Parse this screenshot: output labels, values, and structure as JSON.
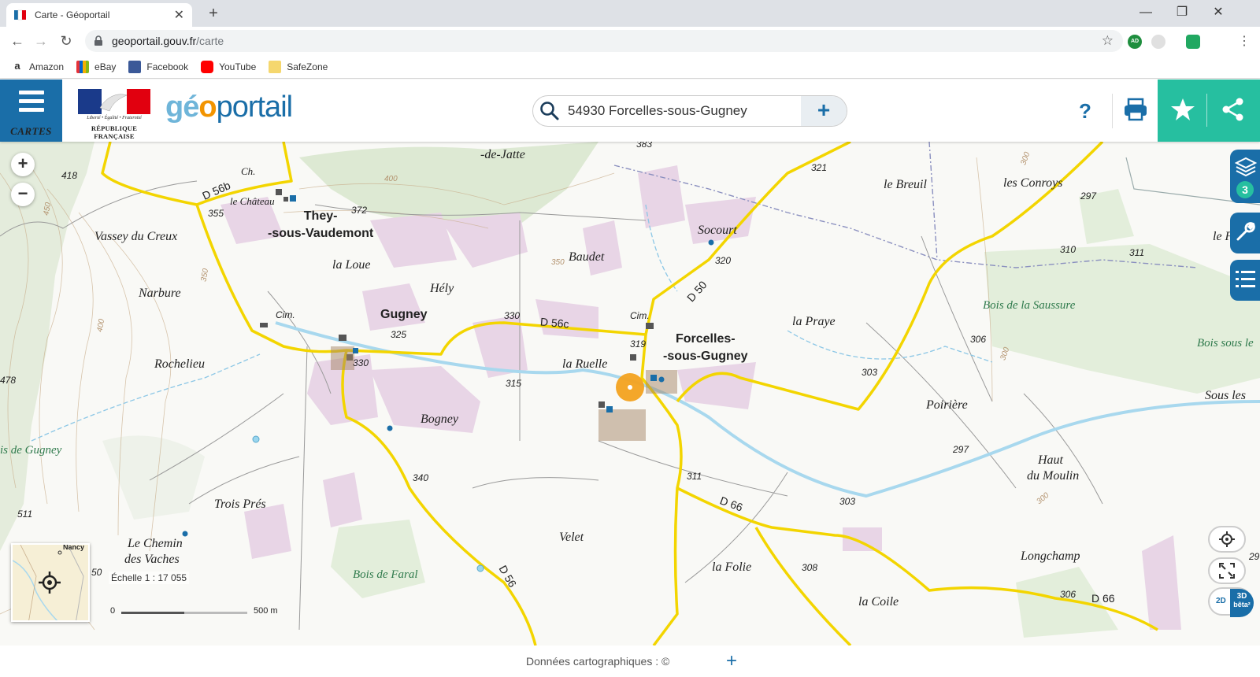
{
  "browser": {
    "tab_title": "Carte - Géoportail",
    "url_host": "geoportail.gouv.fr",
    "url_path": "/carte",
    "bookmarks": [
      "Amazon",
      "eBay",
      "Facebook",
      "YouTube",
      "SafeZone"
    ],
    "ext_ad_label": "AD"
  },
  "header": {
    "cartes_label": "CARTES",
    "rf_devise": "Liberté • Égalité • Fraternité",
    "rf_rep": "RÉPUBLIQUE FRANÇAISE",
    "logo_a": "gé",
    "logo_b": "o",
    "logo_c": "portail",
    "search_value": "54930 Forcelles-sous-Gugney",
    "help_label": "?"
  },
  "map": {
    "places": [
      "They-",
      "-sous-Vaudemont",
      "Gugney",
      "Forcelles-",
      "-sous-Gugney"
    ],
    "localities": [
      "-de-Jatte",
      "le Château",
      "Vassey du Creux",
      "la Loue",
      "Hély",
      "Baudet",
      "Socourt",
      "le Breuil",
      "les Conroys",
      "Narbure",
      "Rochelieu",
      "la Ruelle",
      "la Praye",
      "Bogney",
      "Poirière",
      "Haut",
      "du Moulin",
      "Trois Prés",
      "Velet",
      "Le Chemin",
      "des Vaches",
      "la Folie",
      "la Coile",
      "Longchamp",
      "Sous les",
      "le F",
      "Ch."
    ],
    "woods": [
      "Bois de la Saussure",
      "Bois de Faral",
      "Bois sous le",
      "is de Gugney"
    ],
    "roads": [
      "D 56b",
      "D 56c",
      "D 50",
      "D 66",
      "D 56",
      "D 66",
      "Cim.",
      "Cim."
    ],
    "altitudes": [
      "383",
      "418",
      "355",
      "372",
      "330",
      "325",
      "330",
      "319",
      "321",
      "320",
      "297",
      "310",
      "311",
      "306",
      "303",
      "315",
      "297",
      "303",
      "311",
      "308",
      "306",
      "340",
      "511",
      "478",
      "50",
      "29",
      "31"
    ],
    "contours": [
      "400",
      "450",
      "350",
      "400",
      "350",
      "300",
      "300",
      "300"
    ],
    "layer_count": "3",
    "overview_label": "Nancy",
    "scale_text": "Échelle 1 : 17 055",
    "scale_start": "0",
    "scale_end": "500 m",
    "btn_2d": "2D",
    "btn_3d": "3D",
    "btn_beta": "bêta²"
  },
  "footer": {
    "credit": "Données cartographiques : ©",
    "plus": "+"
  },
  "colors": {
    "brand_blue": "#1a6ea8",
    "brand_green": "#26bfa0",
    "road_yellow": "#f3d500",
    "wood_green": "#dde9d3",
    "urban_mauve": "#e6d3e4"
  }
}
